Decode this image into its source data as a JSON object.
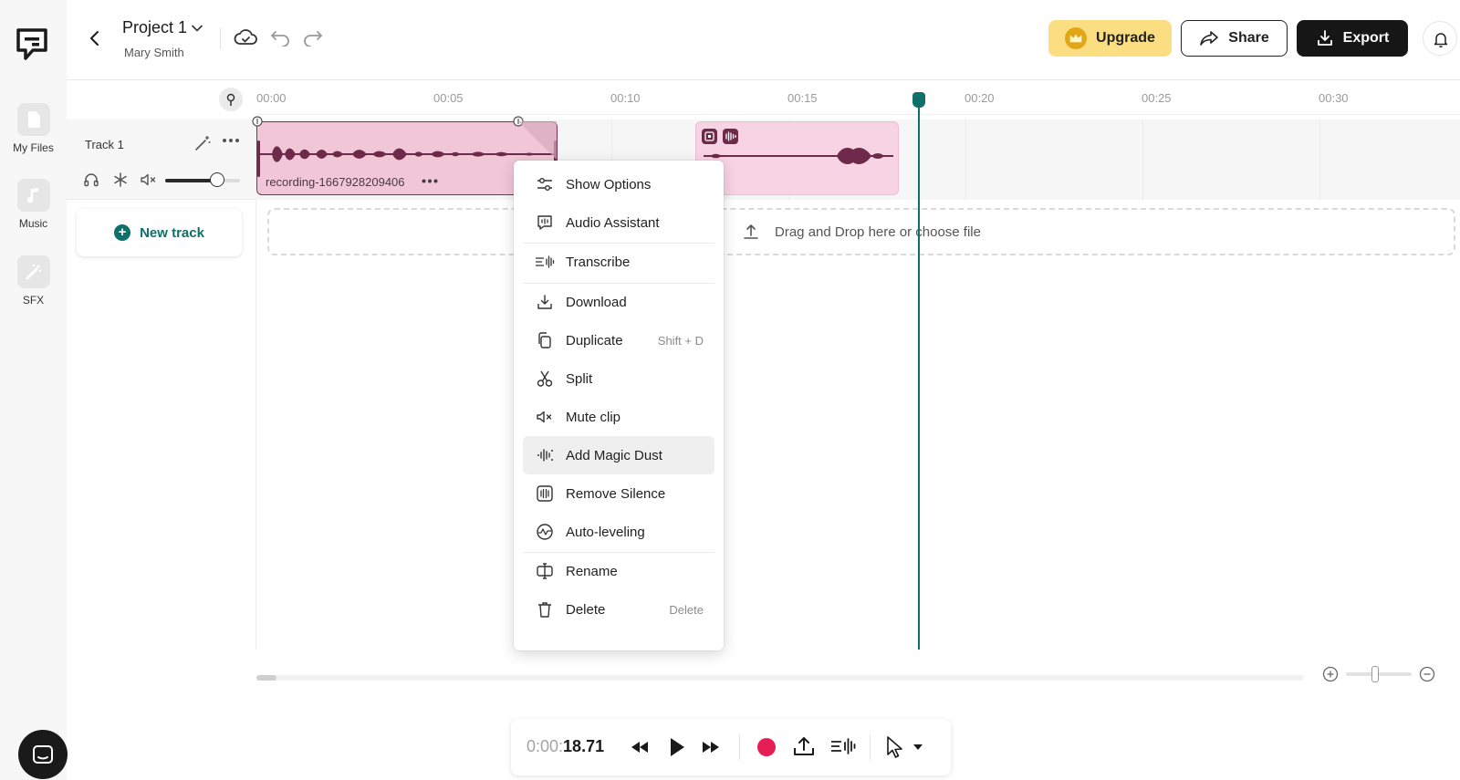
{
  "sidebar": {
    "items": [
      {
        "label": "My Files",
        "icon": "file-icon"
      },
      {
        "label": "Music",
        "icon": "music-note-icon"
      },
      {
        "label": "SFX",
        "icon": "magic-wand-icon"
      }
    ]
  },
  "header": {
    "project_name": "Project 1",
    "owner": "Mary Smith",
    "upgrade_label": "Upgrade",
    "share_label": "Share",
    "export_label": "Export"
  },
  "timeline": {
    "ticks": [
      "00:00",
      "00:05",
      "00:10",
      "00:15",
      "00:20",
      "00:25",
      "00:30"
    ],
    "playhead_seconds": 18.71
  },
  "track": {
    "name": "Track 1",
    "volume_fraction": 0.69
  },
  "new_track_label": "New track",
  "clips": [
    {
      "name": "recording-1667928209406"
    }
  ],
  "drop_zone_text": "Drag and Drop here or choose file",
  "context_menu": {
    "items": [
      {
        "label": "Show Options",
        "icon": "sliders-icon",
        "shortcut": ""
      },
      {
        "label": "Audio Assistant",
        "icon": "audio-assistant-icon",
        "shortcut": ""
      },
      {
        "label": "Transcribe",
        "icon": "transcribe-icon",
        "shortcut": ""
      },
      {
        "label": "Download",
        "icon": "download-icon",
        "shortcut": ""
      },
      {
        "label": "Duplicate",
        "icon": "duplicate-icon",
        "shortcut": "Shift + D"
      },
      {
        "label": "Split",
        "icon": "scissors-icon",
        "shortcut": ""
      },
      {
        "label": "Mute clip",
        "icon": "mute-icon",
        "shortcut": ""
      },
      {
        "label": "Add Magic Dust",
        "icon": "magic-dust-icon",
        "shortcut": ""
      },
      {
        "label": "Remove Silence",
        "icon": "remove-silence-icon",
        "shortcut": ""
      },
      {
        "label": "Auto-leveling",
        "icon": "auto-leveling-icon",
        "shortcut": ""
      },
      {
        "label": "Rename",
        "icon": "rename-icon",
        "shortcut": ""
      },
      {
        "label": "Delete",
        "icon": "trash-icon",
        "shortcut": "Delete"
      }
    ],
    "highlighted": "Add Magic Dust"
  },
  "transport": {
    "time_prefix": "0:00:",
    "time_main": "18.71"
  },
  "zoom": {
    "level_fraction": 0.44
  },
  "colors": {
    "accent": "#0f6f6a",
    "upgrade": "#fbde82",
    "clip": "#f1c7d8",
    "waveform": "#6d2a4b",
    "record": "#e51f55"
  }
}
